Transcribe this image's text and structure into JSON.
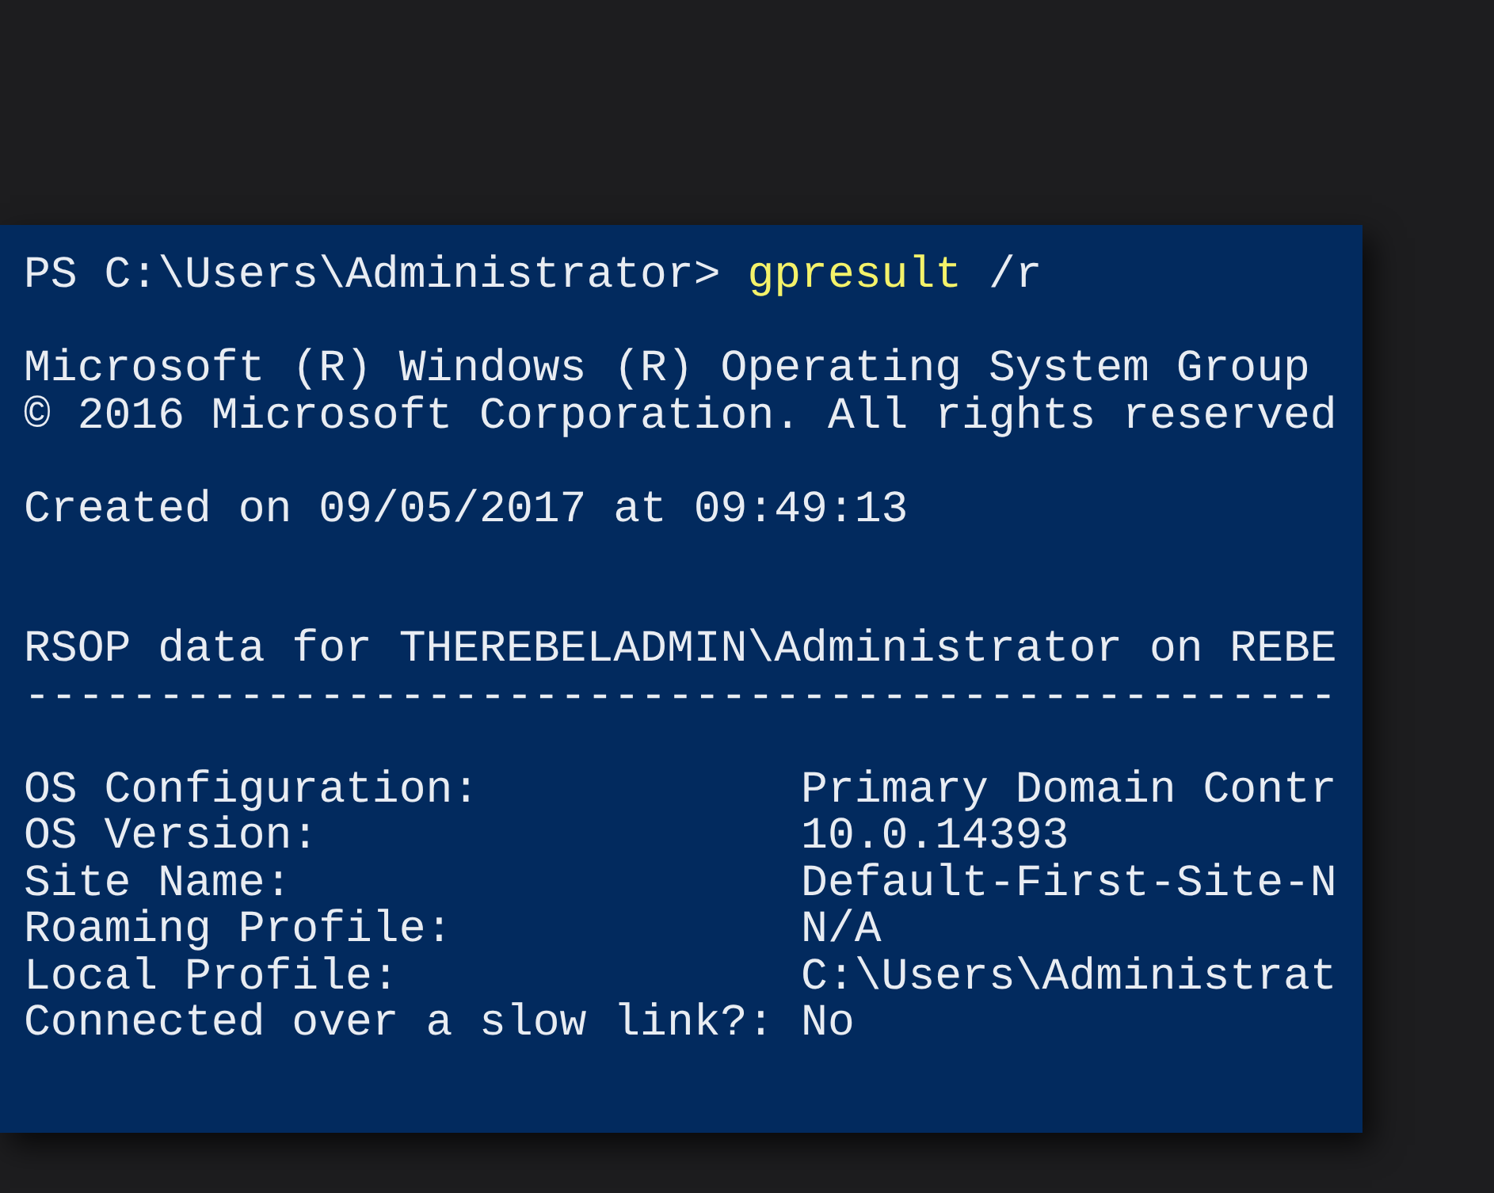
{
  "terminal": {
    "prompt": "PS C:\\Users\\Administrator>",
    "command": "gpresult",
    "argument": "/r",
    "banner": [
      "Microsoft (R) Windows (R) Operating System Group",
      "© 2016 Microsoft Corporation. All rights reserved"
    ],
    "created": "Created on 09/05/2017 at 09:49:13",
    "rsop_header": "RSOP data for THEREBELADMIN\\Administrator on REBE",
    "separator": "-------------------------------------------------",
    "fields": [
      {
        "label": "OS Configuration:",
        "value": "Primary Domain Contr"
      },
      {
        "label": "OS Version:",
        "value": "10.0.14393"
      },
      {
        "label": "Site Name:",
        "value": "Default-First-Site-N"
      },
      {
        "label": "Roaming Profile:",
        "value": "N/A"
      },
      {
        "label": "Local Profile:",
        "value": "C:\\Users\\Administrat"
      },
      {
        "label": "Connected over a slow link?:",
        "value": "No"
      }
    ]
  }
}
